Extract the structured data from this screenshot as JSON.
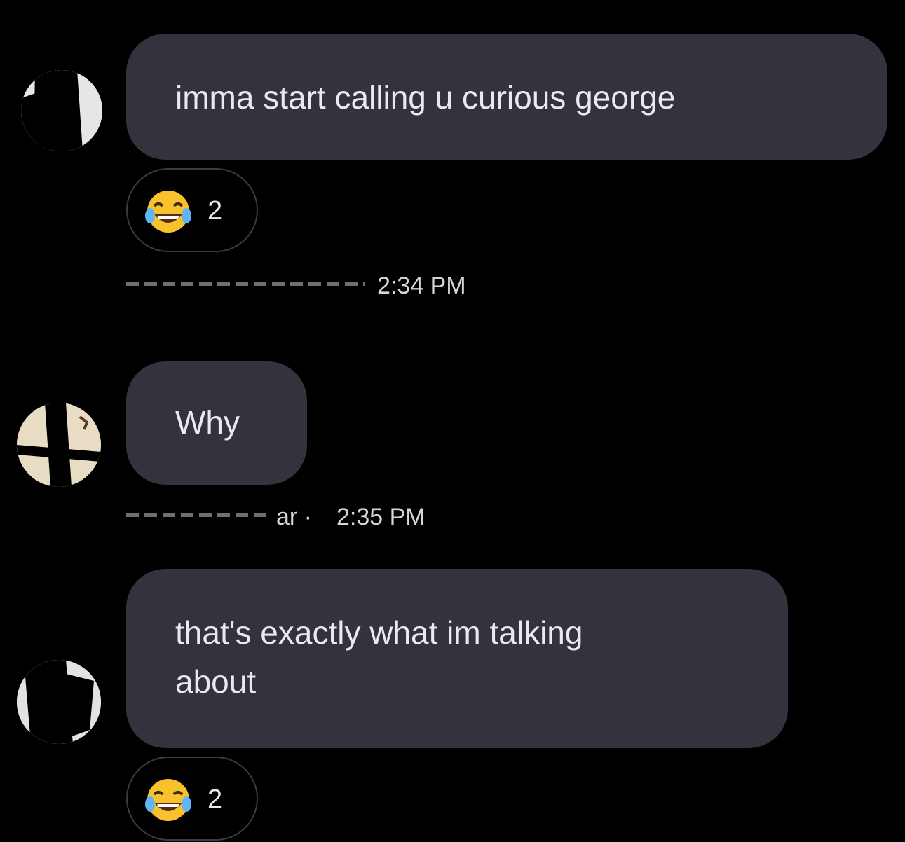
{
  "messages": [
    {
      "text": "imma start calling u curious george",
      "reaction": {
        "emoji": "face-with-tears-of-joy",
        "count": "2"
      },
      "time": "2:34 PM"
    },
    {
      "text": "Why",
      "meta_fragment": "ar ·",
      "time": "2:35 PM"
    },
    {
      "text": "that's exactly what im talking\nabout",
      "reaction": {
        "emoji": "face-with-tears-of-joy",
        "count": "2"
      }
    }
  ],
  "colors": {
    "background": "#000000",
    "bubble": "#32333c",
    "text": "#e9e9ef"
  }
}
